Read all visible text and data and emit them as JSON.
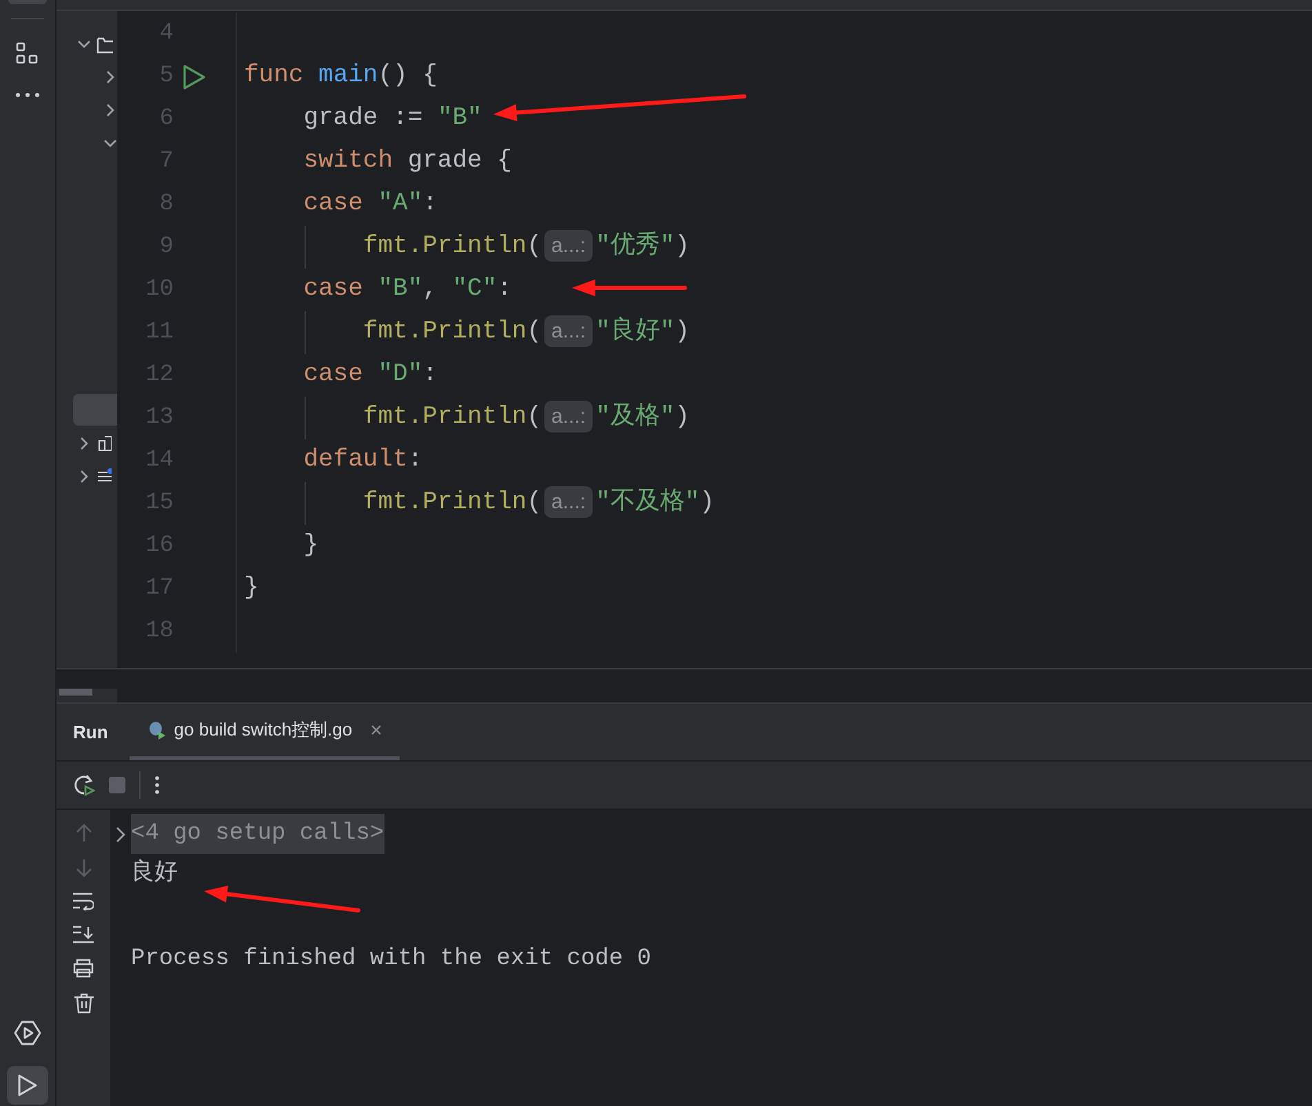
{
  "editor": {
    "lines": [
      {
        "number": "4"
      },
      {
        "number": "5",
        "run": true,
        "tokens": [
          {
            "kind": "keyword",
            "text": "func "
          },
          {
            "kind": "function",
            "text": "main"
          },
          {
            "kind": "plain",
            "text": "() {"
          }
        ]
      },
      {
        "number": "6",
        "tokens": [
          {
            "kind": "plain",
            "text": "    grade := "
          },
          {
            "kind": "string",
            "text": "\"B\""
          }
        ]
      },
      {
        "number": "7",
        "tokens": [
          {
            "kind": "keyword",
            "text": "    switch "
          },
          {
            "kind": "plain",
            "text": "grade {"
          }
        ]
      },
      {
        "number": "8",
        "tokens": [
          {
            "kind": "keyword",
            "text": "    case "
          },
          {
            "kind": "string",
            "text": "\"A\""
          },
          {
            "kind": "plain",
            "text": ":"
          }
        ]
      },
      {
        "number": "9",
        "guide": true,
        "tokens": [
          {
            "kind": "call",
            "text": "        fmt.Println"
          },
          {
            "kind": "plain",
            "text": "("
          },
          {
            "kind": "hint",
            "text": "a...:"
          },
          {
            "kind": "string",
            "text": "\"优秀\""
          },
          {
            "kind": "plain",
            "text": ")"
          }
        ]
      },
      {
        "number": "10",
        "tokens": [
          {
            "kind": "keyword",
            "text": "    case "
          },
          {
            "kind": "string",
            "text": "\"B\""
          },
          {
            "kind": "plain",
            "text": ", "
          },
          {
            "kind": "string",
            "text": "\"C\""
          },
          {
            "kind": "plain",
            "text": ":"
          }
        ]
      },
      {
        "number": "11",
        "guide": true,
        "tokens": [
          {
            "kind": "call",
            "text": "        fmt.Println"
          },
          {
            "kind": "plain",
            "text": "("
          },
          {
            "kind": "hint",
            "text": "a...:"
          },
          {
            "kind": "string",
            "text": "\"良好\""
          },
          {
            "kind": "plain",
            "text": ")"
          }
        ]
      },
      {
        "number": "12",
        "tokens": [
          {
            "kind": "keyword",
            "text": "    case "
          },
          {
            "kind": "string",
            "text": "\"D\""
          },
          {
            "kind": "plain",
            "text": ":"
          }
        ]
      },
      {
        "number": "13",
        "guide": true,
        "tokens": [
          {
            "kind": "call",
            "text": "        fmt.Println"
          },
          {
            "kind": "plain",
            "text": "("
          },
          {
            "kind": "hint",
            "text": "a...:"
          },
          {
            "kind": "string",
            "text": "\"及格\""
          },
          {
            "kind": "plain",
            "text": ")"
          }
        ]
      },
      {
        "number": "14",
        "tokens": [
          {
            "kind": "keyword",
            "text": "    default"
          },
          {
            "kind": "plain",
            "text": ":"
          }
        ]
      },
      {
        "number": "15",
        "guide": true,
        "tokens": [
          {
            "kind": "call",
            "text": "        fmt.Println"
          },
          {
            "kind": "plain",
            "text": "("
          },
          {
            "kind": "hint",
            "text": "a...:"
          },
          {
            "kind": "string",
            "text": "\"不及格\""
          },
          {
            "kind": "plain",
            "text": ")"
          }
        ]
      },
      {
        "number": "16",
        "tokens": [
          {
            "kind": "plain",
            "text": "    }"
          }
        ]
      },
      {
        "number": "17",
        "tokens": [
          {
            "kind": "plain",
            "text": "}"
          }
        ]
      },
      {
        "number": "18"
      }
    ]
  },
  "run_panel": {
    "title": "Run",
    "tabs": [
      {
        "label": "go build switch控制.go",
        "selected": true
      }
    ],
    "output": [
      {
        "kind": "folded",
        "text": "<4 go setup calls>"
      },
      {
        "kind": "plain",
        "text": "良好"
      },
      {
        "kind": "exit",
        "text": "Process finished with the exit code 0"
      }
    ]
  }
}
